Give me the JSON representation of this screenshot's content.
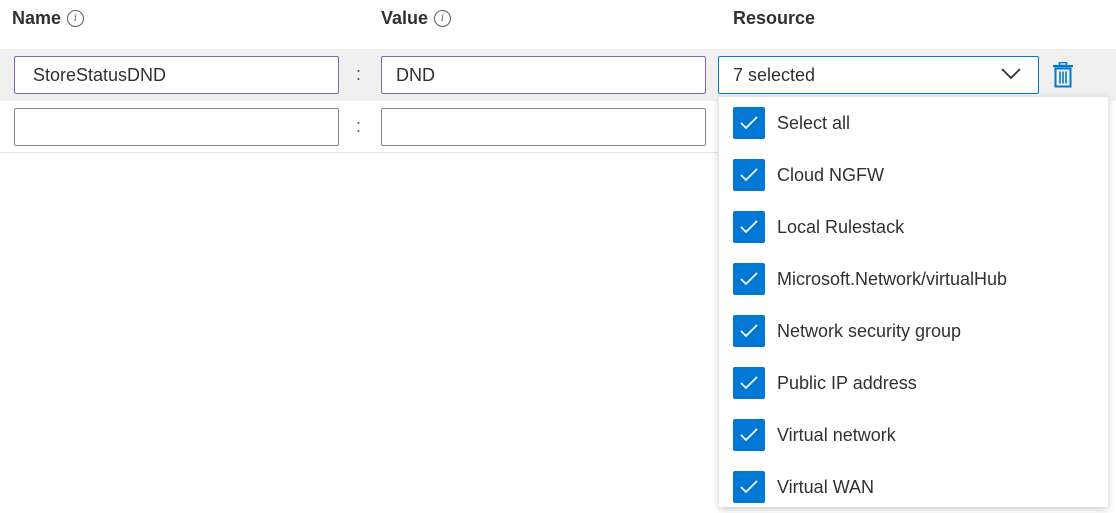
{
  "headers": {
    "name": "Name",
    "value": "Value",
    "resource": "Resource"
  },
  "rows": [
    {
      "name": "StoreStatusDND",
      "value": "DND",
      "separator": ":"
    },
    {
      "name": "",
      "value": "",
      "separator": ":"
    }
  ],
  "resource_dropdown": {
    "selected_text": "7 selected",
    "options": [
      {
        "label": "Select all",
        "checked": true
      },
      {
        "label": "Cloud NGFW",
        "checked": true
      },
      {
        "label": "Local Rulestack",
        "checked": true
      },
      {
        "label": "Microsoft.Network/virtualHub",
        "checked": true
      },
      {
        "label": "Network security group",
        "checked": true
      },
      {
        "label": "Public IP address",
        "checked": true
      },
      {
        "label": "Virtual network",
        "checked": true
      },
      {
        "label": "Virtual WAN",
        "checked": true
      }
    ]
  },
  "icons": {
    "info": "info-icon",
    "chevron": "chevron-down-icon",
    "delete": "trash-icon",
    "check": "checkmark-icon"
  },
  "colors": {
    "accent": "#0078d4",
    "focus_border": "#8764b8",
    "row_highlight": "#f0f0f0"
  }
}
